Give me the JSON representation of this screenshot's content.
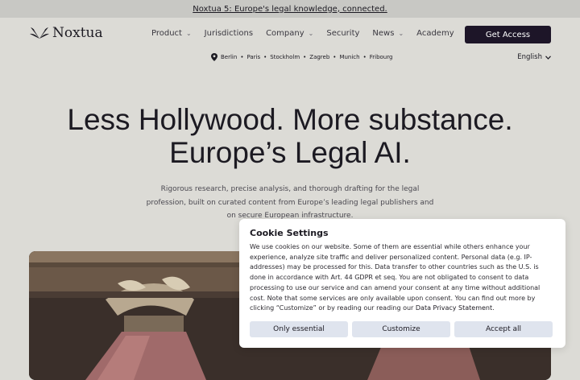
{
  "announcement": {
    "text": "Noxtua 5: Europe's legal knowledge, connected."
  },
  "brand": {
    "name": "Noxtua"
  },
  "nav": {
    "items": [
      {
        "label": "Product",
        "has_dropdown": true
      },
      {
        "label": "Jurisdictions",
        "has_dropdown": false
      },
      {
        "label": "Company",
        "has_dropdown": true
      },
      {
        "label": "Security",
        "has_dropdown": false
      },
      {
        "label": "News",
        "has_dropdown": true
      },
      {
        "label": "Academy",
        "has_dropdown": false
      }
    ],
    "cta_label": "Get Access"
  },
  "locations": [
    "Berlin",
    "Paris",
    "Stockholm",
    "Zagreb",
    "Munich",
    "Fribourg"
  ],
  "language": {
    "selected": "English"
  },
  "hero": {
    "title_line1": "Less Hollywood. More substance.",
    "title_line2": "Europe’s Legal AI.",
    "subtitle": "Rigorous research, precise analysis, and thorough drafting for the legal profession, built on curated content from Europe’s leading legal publishers and on secure European infrastructure."
  },
  "cookie": {
    "title": "Cookie Settings",
    "body": "We use cookies on our website. Some of them are essential while others enhance your experience, analyze site traffic and deliver personalized content. Personal data (e.g. IP-addresses) may be processed for this. Data transfer to other countries such as the U.S. is done in accordance with Art. 44 GDPR et seq. You are not obligated to consent to data processing to use our service and can amend your consent at any time without additional cost. Note that some services are only available upon consent. You can find out more by clicking “Customize” or by reading our reading our ",
    "link_text": "Data Privacy Statement",
    "body_end": ".",
    "buttons": {
      "essential": "Only essential",
      "customize": "Customize",
      "accept": "Accept all"
    }
  },
  "colors": {
    "background": "#dcdbd6",
    "announcement_bar": "#c8c8c4",
    "cta": "#1d1528",
    "cookie_button": "#dfe4ee"
  }
}
